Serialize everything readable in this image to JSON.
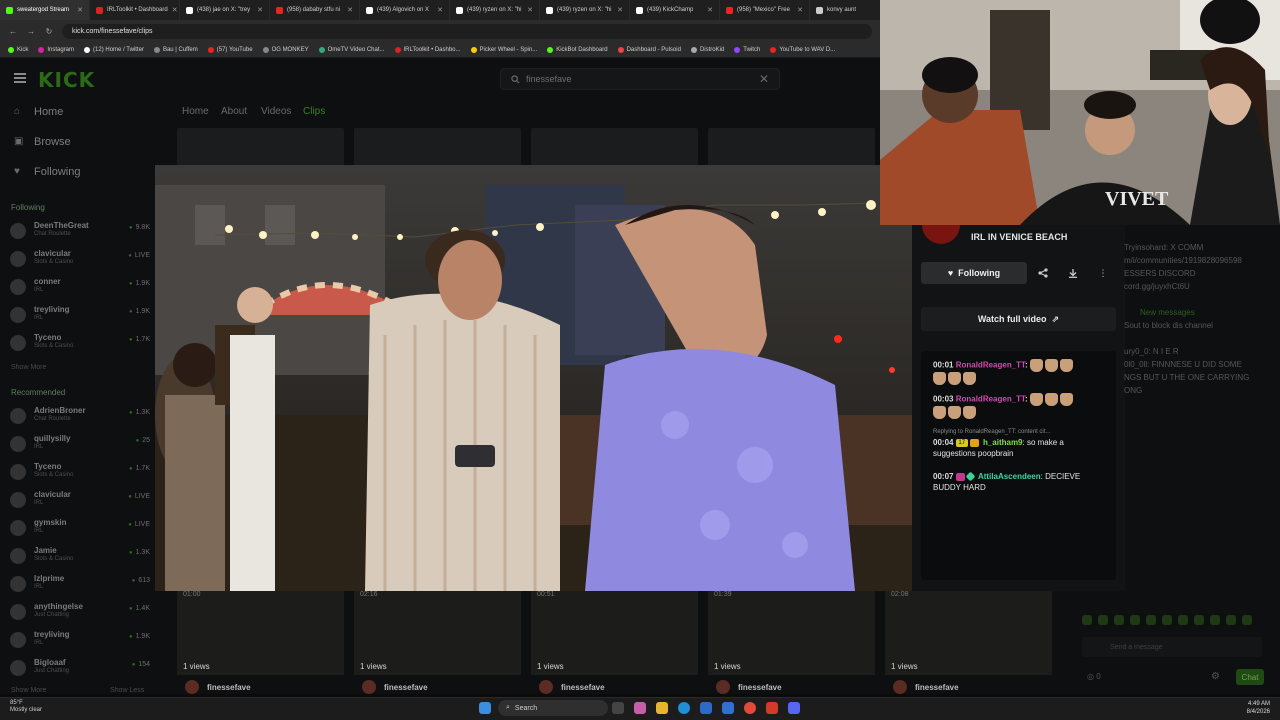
{
  "browser": {
    "tabs": [
      {
        "label": "sweatergod Stream",
        "color": "#53fc18",
        "active": true
      },
      {
        "label": "IRLToolkit • Dashboard",
        "color": "#d22"
      },
      {
        "label": "(438) jae on X: \"trey",
        "color": "#fff"
      },
      {
        "label": "(958) dababy stfu ni",
        "color": "#e22"
      },
      {
        "label": "(439) Algovich on X",
        "color": "#fff"
      },
      {
        "label": "(439) ryzen on X: \"hi",
        "color": "#fff"
      },
      {
        "label": "(439) ryzen on X: \"hi",
        "color": "#fff"
      },
      {
        "label": "(439) KickChamp",
        "color": "#fff"
      },
      {
        "label": "(958) \"Mexico\" Free",
        "color": "#e22"
      },
      {
        "label": "konvy aunt",
        "color": "#ccc"
      }
    ],
    "url": "kick.com/finessefave/clips",
    "bookmarks": [
      {
        "label": "Kick",
        "color": "#53fc18"
      },
      {
        "label": "Instagram",
        "color": "#d6249f"
      },
      {
        "label": "(12) Home / Twitter",
        "color": "#fff"
      },
      {
        "label": "Bau | Cuffem",
        "color": "#888"
      },
      {
        "label": "(57) YouTube",
        "color": "#e22"
      },
      {
        "label": "OG MONKEY",
        "color": "#888"
      },
      {
        "label": "OmeTV Video Chat...",
        "color": "#3a7"
      },
      {
        "label": "IRLToolkit • Dashbo...",
        "color": "#d22"
      },
      {
        "label": "Picker Wheel - Spin...",
        "color": "#fc0"
      },
      {
        "label": "KickBot Dashboard",
        "color": "#53fc18"
      },
      {
        "label": "Dashboard - Pulsoid",
        "color": "#e44"
      },
      {
        "label": "DistroKid",
        "color": "#aaa"
      },
      {
        "label": "Twitch",
        "color": "#9146ff"
      },
      {
        "label": "YouTube to WAV D...",
        "color": "#e22"
      }
    ]
  },
  "kick": {
    "logo": "KICK",
    "search_value": "finessefave",
    "nav": [
      {
        "label": "Home",
        "icon": "home-icon"
      },
      {
        "label": "Browse",
        "icon": "browse-icon"
      },
      {
        "label": "Following",
        "icon": "heart-icon"
      }
    ],
    "following_heading": "Following",
    "following": [
      {
        "name": "DeenTheGreat",
        "cat": "Chat Roulette",
        "viewers": "9.8K"
      },
      {
        "name": "clavicular",
        "cat": "Slots & Casino",
        "viewers": "LIVE"
      },
      {
        "name": "conner",
        "cat": "IRL",
        "viewers": "1.9K"
      },
      {
        "name": "treyliving",
        "cat": "IRL",
        "viewers": "1.9K"
      },
      {
        "name": "Tyceno",
        "cat": "Slots & Casino",
        "viewers": "1.7K"
      }
    ],
    "show_more": "Show More",
    "recommended_heading": "Recommended",
    "recommended": [
      {
        "name": "AdrienBroner",
        "cat": "Chat Roulette",
        "viewers": "1.3K"
      },
      {
        "name": "quillysilly",
        "cat": "IRL",
        "viewers": "25"
      },
      {
        "name": "Tyceno",
        "cat": "Slots & Casino",
        "viewers": "1.7K"
      },
      {
        "name": "clavicular",
        "cat": "IRL",
        "viewers": "LIVE"
      },
      {
        "name": "gymskin",
        "cat": "IRL",
        "viewers": "LIVE"
      },
      {
        "name": "Jamie",
        "cat": "Slots & Casino",
        "viewers": "1.3K"
      },
      {
        "name": "lzlprime",
        "cat": "IRL",
        "viewers": "613"
      },
      {
        "name": "anythingelse",
        "cat": "Just Chatting",
        "viewers": "1.4K"
      },
      {
        "name": "treyliving",
        "cat": "IRL",
        "viewers": "1.9K"
      },
      {
        "name": "Bigloaaf",
        "cat": "Just Chatting",
        "viewers": "154"
      }
    ],
    "show_less": "Show Less",
    "page_tabs": [
      "Home",
      "About",
      "Videos",
      "Clips"
    ],
    "clip_panel": {
      "title": "IRL IN VENICE BEACH",
      "follow_label": "Following",
      "watch_label": "Watch full video",
      "messages": [
        {
          "time": "00:01",
          "user": "RonaldReagen_TT",
          "text": ""
        },
        {
          "time": "00:03",
          "user": "RonaldReagen_TT",
          "text": ""
        },
        {
          "time": "00:04",
          "user": "h_aitham9",
          "text": "so make a suggestions poopbrain",
          "badge_num": "17"
        },
        {
          "time": "00:07",
          "user": "AttilaAscendeen",
          "text": "DECIEVE BUDDY HARD"
        }
      ],
      "reply_text": "Replying to RonaldReagen_TT: content cit..."
    },
    "clips": [
      {
        "duration": "01:00",
        "views": "1 views",
        "author": "finessefave"
      },
      {
        "duration": "02:16",
        "views": "1 views",
        "author": "finessefave"
      },
      {
        "duration": "00:51",
        "views": "1 views",
        "author": "finessefave"
      },
      {
        "duration": "01:39",
        "views": "1 views",
        "author": "finessefave"
      },
      {
        "duration": "02:08",
        "views": "1 views",
        "author": "finessefave"
      }
    ],
    "right_chat": {
      "lines": [
        "Tryinsohard: X COMM",
        "m/i/communities/1919828096598",
        "ESSERS DISCORD",
        "cord.gg/juyxhCt6U",
        "",
        "New messages",
        "Sout to block dis channel",
        "",
        "ury0_0: N I  E R",
        "0l0_0ll: FINNNESE U DID SOME",
        "NGS BUT U THE ONE CARRYING",
        "ONG"
      ],
      "send_placeholder": "Send a message",
      "chat_button": "Chat",
      "viewer_count": "0"
    }
  },
  "taskbar": {
    "weather_temp": "85°F",
    "weather_desc": "Mostly clear",
    "search_label": "Search",
    "time": "4:49 AM",
    "date": "8/4/2026"
  }
}
